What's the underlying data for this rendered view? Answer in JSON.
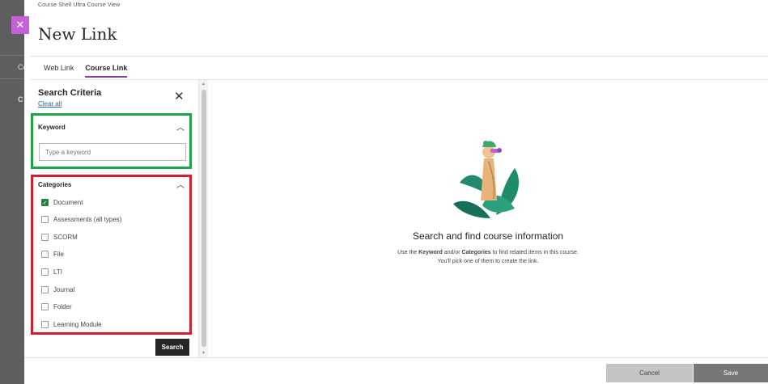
{
  "window": {
    "close_icon": "close-icon",
    "breadcrumb": "Course Shell Ultra Course View",
    "title": "New Link",
    "background_labels": [
      "Co",
      "C"
    ]
  },
  "tabs": [
    {
      "label": "Web Link",
      "active": false
    },
    {
      "label": "Course Link",
      "active": true
    }
  ],
  "search_panel": {
    "title": "Search Criteria",
    "clear_all": "Clear all",
    "keyword": {
      "heading": "Keyword",
      "placeholder": "Type a keyword",
      "value": ""
    },
    "categories": {
      "heading": "Categories",
      "items": [
        {
          "label": "Document",
          "checked": true
        },
        {
          "label": "Assessments (all types)",
          "checked": false
        },
        {
          "label": "SCORM",
          "checked": false
        },
        {
          "label": "File",
          "checked": false
        },
        {
          "label": "LTI",
          "checked": false
        },
        {
          "label": "Journal",
          "checked": false
        },
        {
          "label": "Folder",
          "checked": false
        },
        {
          "label": "Learning Module",
          "checked": false
        }
      ]
    },
    "search_button": "Search"
  },
  "empty_state": {
    "title": "Search and find course information",
    "line1_pre": "Use the ",
    "line1_keyword": "Keyword",
    "line1_mid": " and/or ",
    "line1_categories": "Categories",
    "line1_post": " to find related items in this course.",
    "line2": "You'll pick one of them to create the link."
  },
  "footer": {
    "cancel": "Cancel",
    "save": "Save"
  },
  "colors": {
    "accent": "#8a3ea1",
    "close_tab": "#c561d6",
    "checkbox_checked": "#25843e",
    "highlight_green": "#21a34a",
    "highlight_red": "#d31e2d"
  }
}
